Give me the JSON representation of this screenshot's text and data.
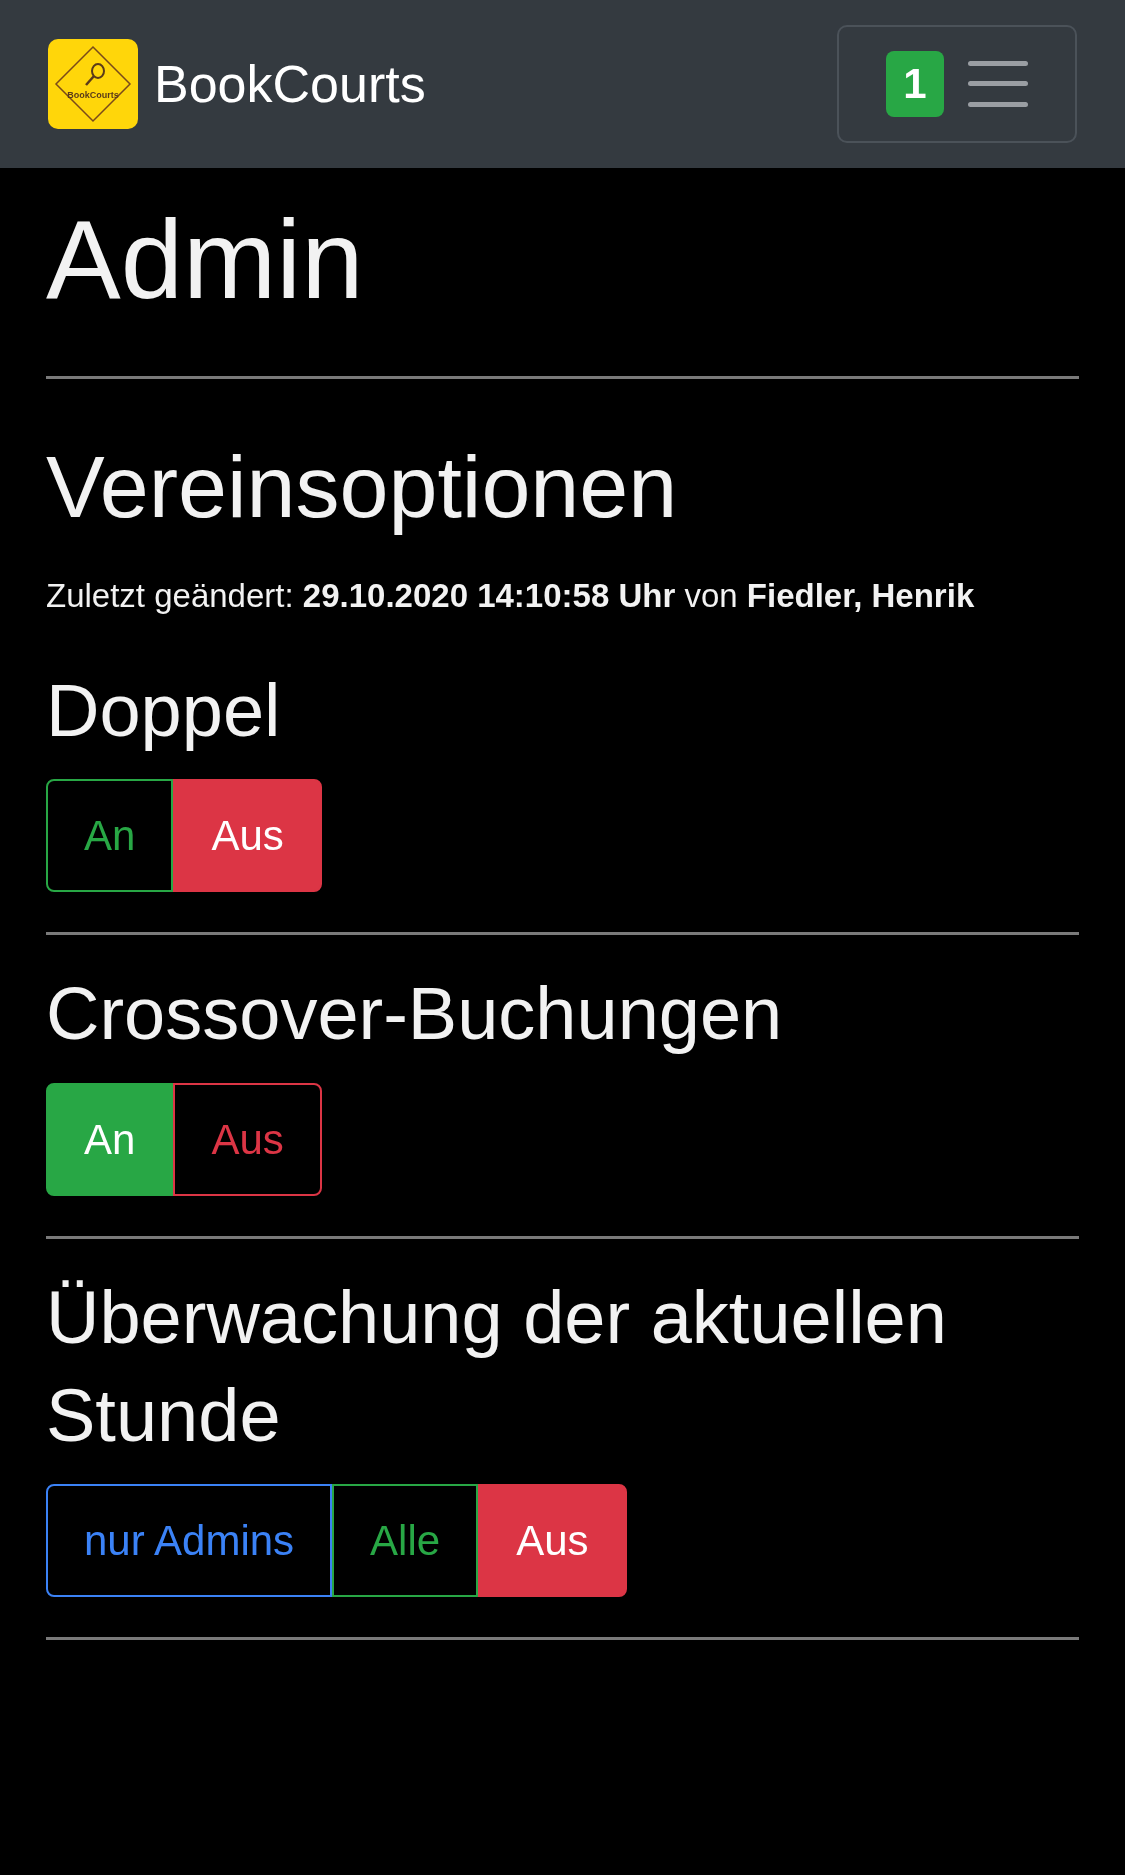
{
  "navbar": {
    "logo_text": "BookCourts",
    "brand": "BookCourts",
    "badge": "1"
  },
  "page_title": "Admin",
  "section_title": "Vereinsoptionen",
  "last_changed": "Zuletzt geändert: **29.10.2020 14:10:58 Uhr** von **Fiedler, Henrik**",
  "options": [
    {
      "title": "Doppel",
      "buttons": [
        {
          "label": "An",
          "color": "#28a745",
          "selected": false
        },
        {
          "label": "Aus",
          "color": "#dc3545",
          "selected": true
        }
      ]
    },
    {
      "title": "Crossover-Buchungen",
      "buttons": [
        {
          "label": "An",
          "color": "#28a745",
          "selected": true
        },
        {
          "label": "Aus",
          "color": "#dc3545",
          "selected": false
        }
      ]
    },
    {
      "title": "Überwachung der aktuellen Stunde",
      "buttons": [
        {
          "label": "nur Admins",
          "color": "#3b82f6",
          "selected": false
        },
        {
          "label": "Alle",
          "color": "#28a745",
          "selected": false
        },
        {
          "label": "Aus",
          "color": "#dc3545",
          "selected": true
        }
      ]
    }
  ]
}
